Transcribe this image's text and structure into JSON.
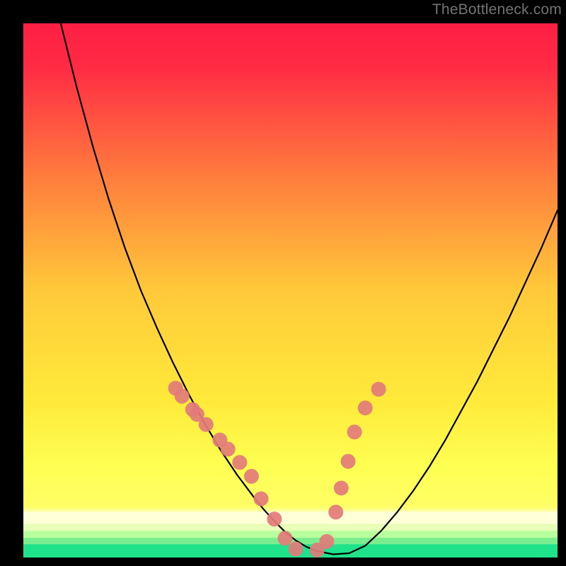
{
  "watermark": "TheBottleneck.com",
  "colors": {
    "frame": "#000000",
    "curve": "#000000",
    "dots_fill": "#e27b79",
    "dots_stroke": "#c55a58",
    "grad_top": "#ff1f44",
    "grad_mid1": "#ff6a3a",
    "grad_mid2": "#ffd93a",
    "grad_yellow": "#ffff66",
    "grad_lightyellow": "#fdffb0",
    "grad_green": "#1fe38a"
  },
  "layout": {
    "outer_w": 800,
    "outer_h": 800,
    "inner_x": 33,
    "inner_y": 33,
    "inner_w": 755,
    "inner_h": 755
  },
  "chart_data": {
    "type": "line",
    "title": "",
    "xlabel": "",
    "ylabel": "",
    "xlim": [
      0,
      100
    ],
    "ylim": [
      0,
      100
    ],
    "series": [
      {
        "name": "curve",
        "x": [
          7,
          10,
          13,
          16,
          19,
          22,
          25,
          28,
          31,
          34,
          37,
          40,
          43,
          45,
          47,
          49,
          51,
          53,
          55,
          58,
          61,
          64,
          67,
          70,
          73,
          76,
          79,
          82,
          85,
          88,
          91,
          94,
          97,
          100
        ],
        "values": [
          100,
          88,
          77,
          67,
          58,
          50,
          43,
          36.5,
          30.5,
          25,
          20,
          15.5,
          11.5,
          9,
          6.8,
          4.8,
          3.2,
          2,
          1.2,
          0.6,
          0.8,
          2.2,
          5,
          8.5,
          12.5,
          17,
          22,
          27.5,
          33,
          39,
          45,
          51.5,
          58,
          65
        ]
      }
    ],
    "points": [
      {
        "name": "dots-left",
        "x": [
          28.5,
          29.7,
          31.7,
          32.5,
          34.2,
          36.8,
          38.3,
          40.5,
          42.7
        ],
        "y": [
          31.7,
          30.2,
          27.7,
          26.8,
          24.9,
          22.0,
          20.3,
          17.8,
          15.2
        ]
      },
      {
        "name": "dots-bottom",
        "x": [
          44.5,
          47.0,
          49.0,
          51.0,
          55.0
        ],
        "y": [
          11.0,
          7.2,
          3.6,
          1.6,
          1.4
        ]
      },
      {
        "name": "dots-right",
        "x": [
          56.8,
          58.5,
          59.5,
          60.8,
          62.0,
          64.0,
          66.5
        ],
        "y": [
          3.0,
          8.5,
          13.0,
          18.0,
          23.5,
          28.0,
          31.5
        ]
      }
    ],
    "gradient_bands": [
      {
        "y0": 6.3,
        "y1": 8.6,
        "color": "#ffffd8"
      },
      {
        "y0": 5.0,
        "y1": 6.3,
        "color": "#e8ffb8"
      },
      {
        "y0": 3.7,
        "y1": 5.0,
        "color": "#b8ff9e"
      },
      {
        "y0": 2.5,
        "y1": 3.7,
        "color": "#7aed8e"
      },
      {
        "y0": 0.0,
        "y1": 2.5,
        "color": "#1fe38a"
      }
    ]
  }
}
